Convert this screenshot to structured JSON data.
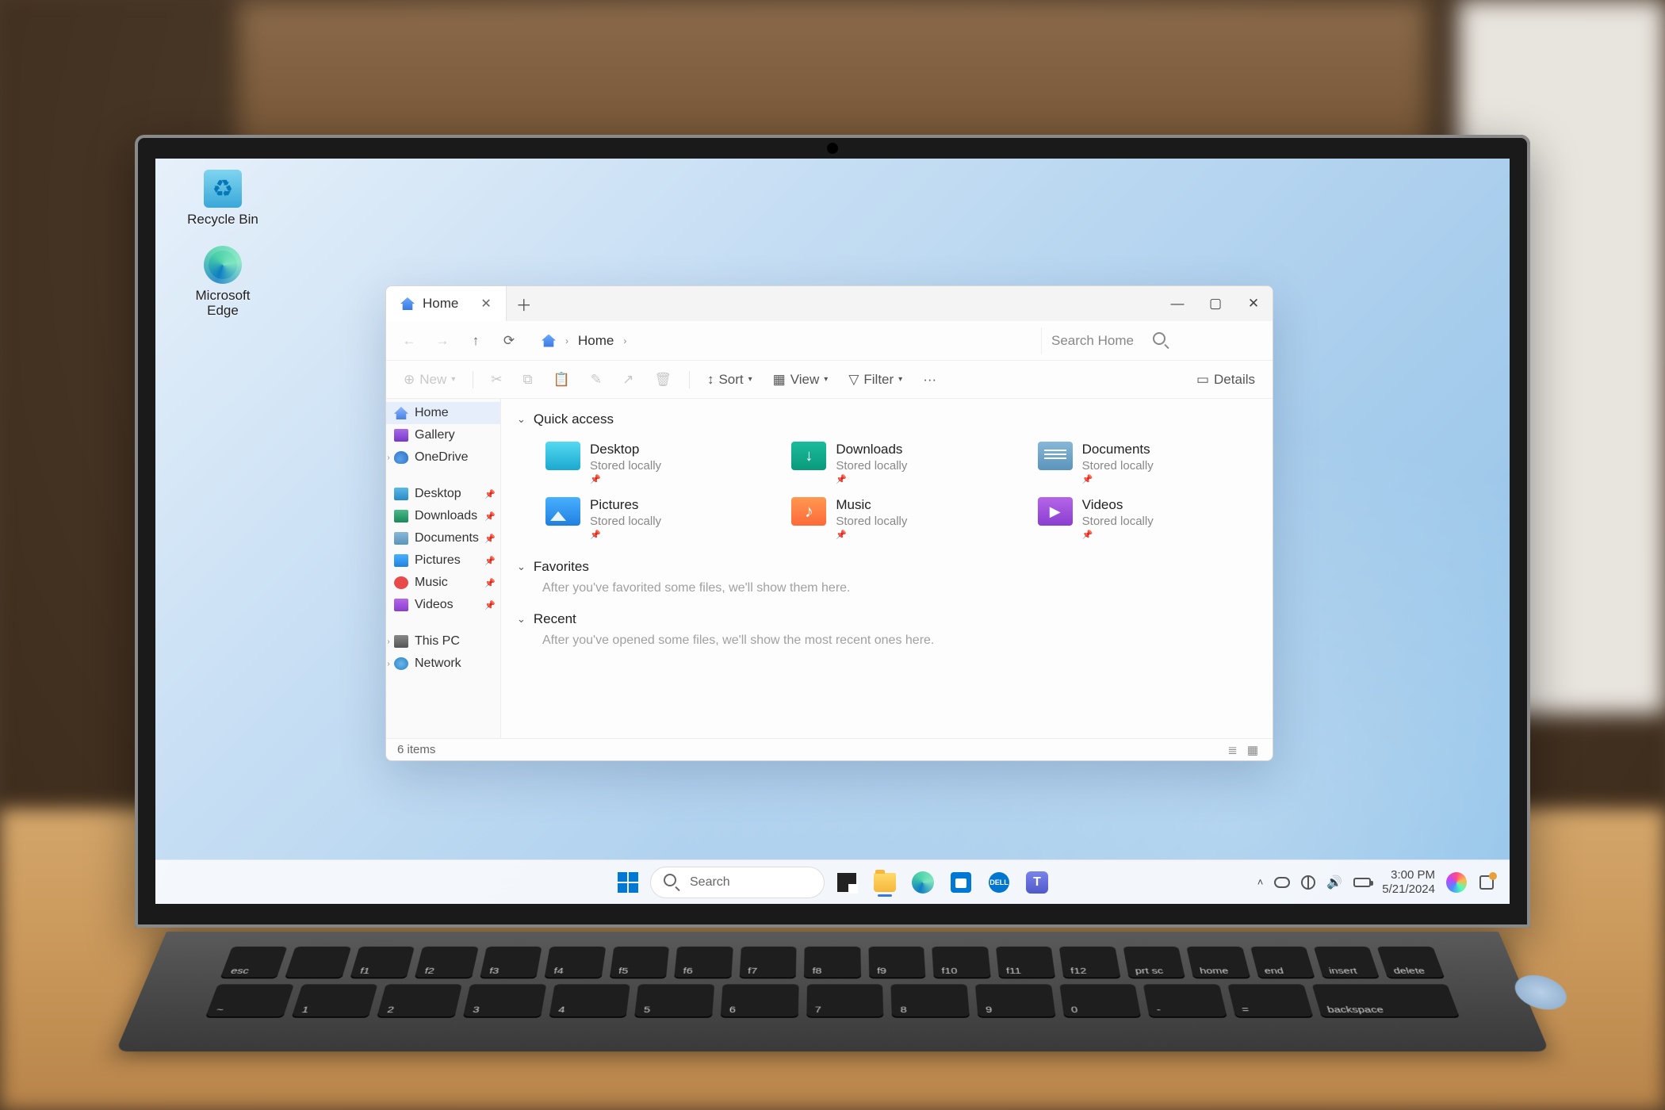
{
  "desktop": {
    "icons": [
      {
        "name": "Recycle Bin",
        "kind": "recycle"
      },
      {
        "name": "Microsoft Edge",
        "kind": "edge"
      }
    ]
  },
  "explorer": {
    "tab_title": "Home",
    "breadcrumb": "Home",
    "search_placeholder": "Search Home",
    "toolbar": {
      "new": "New",
      "sort": "Sort",
      "view": "View",
      "filter": "Filter",
      "details": "Details",
      "more": "···"
    },
    "nav": {
      "top": [
        {
          "label": "Home",
          "icon": "home",
          "selected": true
        },
        {
          "label": "Gallery",
          "icon": "gallery"
        },
        {
          "label": "OneDrive",
          "icon": "onedrive",
          "expandable": true
        }
      ],
      "pinned": [
        {
          "label": "Desktop",
          "icon": "folder"
        },
        {
          "label": "Downloads",
          "icon": "dl"
        },
        {
          "label": "Documents",
          "icon": "doc"
        },
        {
          "label": "Pictures",
          "icon": "pic"
        },
        {
          "label": "Music",
          "icon": "mus"
        },
        {
          "label": "Videos",
          "icon": "vid"
        }
      ],
      "bottom": [
        {
          "label": "This PC",
          "icon": "pc",
          "expandable": true
        },
        {
          "label": "Network",
          "icon": "net",
          "expandable": true
        }
      ]
    },
    "sections": {
      "quick_title": "Quick access",
      "fav_title": "Favorites",
      "fav_empty": "After you've favorited some files, we'll show them here.",
      "recent_title": "Recent",
      "recent_empty": "After you've opened some files, we'll show the most recent ones here."
    },
    "quick_access": [
      {
        "name": "Desktop",
        "loc": "Stored locally",
        "cls": "f-desktop"
      },
      {
        "name": "Downloads",
        "loc": "Stored locally",
        "cls": "f-downloads"
      },
      {
        "name": "Documents",
        "loc": "Stored locally",
        "cls": "f-documents"
      },
      {
        "name": "Pictures",
        "loc": "Stored locally",
        "cls": "f-pictures"
      },
      {
        "name": "Music",
        "loc": "Stored locally",
        "cls": "f-music"
      },
      {
        "name": "Videos",
        "loc": "Stored locally",
        "cls": "f-videos"
      }
    ],
    "status": "6 items"
  },
  "taskbar": {
    "search_placeholder": "Search",
    "time": "3:00 PM",
    "date": "5/21/2024",
    "apps": [
      "start",
      "search",
      "taskview",
      "file-explorer",
      "edge",
      "store",
      "dell",
      "teams"
    ]
  },
  "keyboard": {
    "row1": [
      "esc",
      "",
      "f1",
      "f2",
      "f3",
      "f4",
      "f5",
      "f6",
      "f7",
      "f8",
      "f9",
      "f10",
      "f11",
      "f12",
      "prt sc",
      "home",
      "end",
      "insert",
      "delete"
    ],
    "row2": [
      "~",
      "1",
      "2",
      "3",
      "4",
      "5",
      "6",
      "7",
      "8",
      "9",
      "0",
      "-",
      "=",
      "backspace"
    ]
  }
}
